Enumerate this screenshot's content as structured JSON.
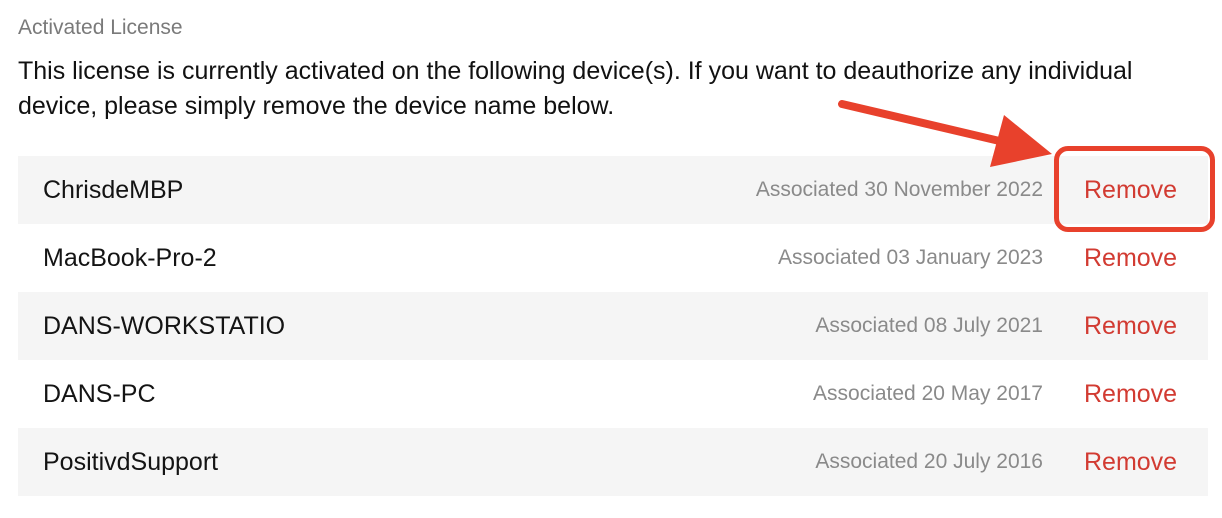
{
  "section": {
    "label": "Activated License"
  },
  "description": "This license is currently activated on the following device(s). If you want to deauthorize any individual device, please simply remove the device name below.",
  "devices": [
    {
      "name": "ChrisdeMBP",
      "associated": "Associated 30 November 2022",
      "action": "Remove"
    },
    {
      "name": "MacBook-Pro-2",
      "associated": "Associated 03 January 2023",
      "action": "Remove"
    },
    {
      "name": "DANS-WORKSTATIO",
      "associated": "Associated 08 July 2021",
      "action": "Remove"
    },
    {
      "name": "DANS-PC",
      "associated": "Associated 20 May 2017",
      "action": "Remove"
    },
    {
      "name": "PositivdSupport",
      "associated": "Associated 20 July 2016",
      "action": "Remove"
    }
  ],
  "annotation": {
    "color": "#e8412c",
    "type": "arrow-icon",
    "target": "Remove"
  },
  "colors": {
    "remove_text": "#d23b32",
    "row_alt_background": "#f5f5f5",
    "muted_text": "#8a8a8a"
  }
}
